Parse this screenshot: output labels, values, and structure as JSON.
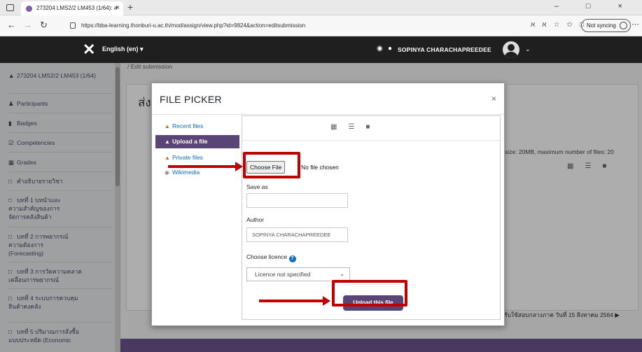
{
  "browser": {
    "tab_title": "273204 LMS2/2 LM453 (1/64): ส่",
    "new_tab": "+",
    "tab_close": "×",
    "url": "https://bba-learning.thonburi-u.ac.th/mod/assign/view.php?id=9824&action=editsubmission",
    "sync_label": "Not syncing",
    "window_controls": "– □ ×"
  },
  "navbar": {
    "language": "English (en) ▾",
    "user_name": "SOPINYA CHARACHAPREEDEE",
    "caret": "⌄"
  },
  "sidebar": {
    "course": "273204 LMS2/2 LM453 (1/64)",
    "items": [
      {
        "label": "Participants",
        "icon": "users-icon"
      },
      {
        "label": "Badges",
        "icon": "shield-icon"
      },
      {
        "label": "Competencies",
        "icon": "checkbox-icon"
      },
      {
        "label": "Grades",
        "icon": "table-icon"
      },
      {
        "label": "คำอธิบายรายวิชา",
        "icon": "folder-icon"
      },
      {
        "label": "บทที่ 1 บทนำและความสำคัญของการจัดการคลังสินค้า",
        "icon": "folder-icon"
      },
      {
        "label": "บทที่ 2 การพยากรณ์ความต้องการ (Forecasting)",
        "icon": "folder-icon"
      },
      {
        "label": "บทที่ 3 การวัดความคลาดเคลื่อนการพยากรณ์",
        "icon": "folder-icon"
      },
      {
        "label": "บทที่ 4 ระบบการควบคุมสินค้าคงคลัง",
        "icon": "folder-icon"
      },
      {
        "label": "บทที่ 5 ปริมาณการสั่งซื้อแบบประหยัด (Economic",
        "icon": "folder-icon"
      }
    ]
  },
  "main": {
    "breadcrumb": "/ Edit submission",
    "page_title": "ส่ง",
    "file_limits": "le size: 20MB, maximum number of files: 20",
    "footer_text": "รับใช้สอบกลางภาค วันที่ 15 สิงหาคม 2564 ▶"
  },
  "file_picker": {
    "title": "FILE PICKER",
    "close": "×",
    "repositories": [
      {
        "label": "Recent files",
        "active": false
      },
      {
        "label": "Upload a file",
        "active": true
      },
      {
        "label": "Private files",
        "active": false
      },
      {
        "label": "Wikimedia",
        "active": false
      }
    ],
    "choose_file_label": "Choose File",
    "no_file_text": "No file chosen",
    "save_as_label": "Save as",
    "save_as_value": "",
    "author_label": "Author",
    "author_value": "SOPINYA CHARACHAPREEDEE",
    "licence_label": "Choose licence",
    "licence_selected": "Licence not specified",
    "upload_button": "Upload this file"
  },
  "colors": {
    "accent_purple": "#5a4577",
    "annotation_red": "#c00000",
    "navbar_bg": "#1f1f1f"
  }
}
